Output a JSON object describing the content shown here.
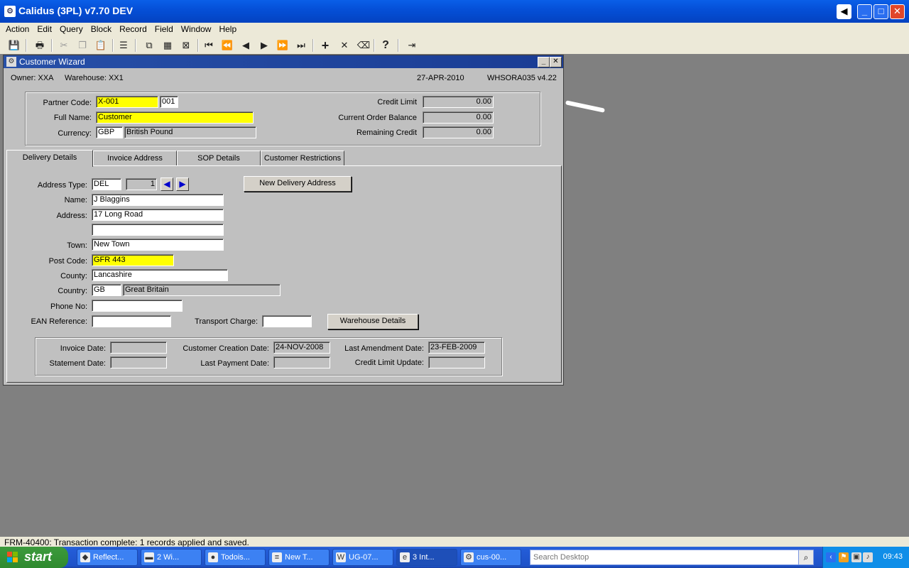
{
  "app": {
    "title": "Calidus (3PL) v7.70 DEV",
    "back_icon": "◀",
    "min_icon": "_",
    "max_icon": "□",
    "close_icon": "✕"
  },
  "menu": [
    "Action",
    "Edit",
    "Query",
    "Block",
    "Record",
    "Field",
    "Window",
    "Help"
  ],
  "form": {
    "title": "Customer Wizard",
    "owner_text": "Owner:  XXA",
    "warehouse_text": "Warehouse:  XX1",
    "date": "27-APR-2010",
    "form_id": "WHSORA035  v4.22",
    "header": {
      "partner_code_label": "Partner Code:",
      "partner_code": "X-001",
      "partner_suffix": "001",
      "full_name_label": "Full Name:",
      "full_name": "Customer",
      "currency_label": "Currency:",
      "currency_code": "GBP",
      "currency_name": "British Pound",
      "credit_limit_label": "Credit Limit",
      "credit_limit": "0.00",
      "order_balance_label": "Current Order Balance",
      "order_balance": "0.00",
      "remaining_credit_label": "Remaining Credit",
      "remaining_credit": "0.00"
    },
    "tabs": [
      "Delivery Details",
      "Invoice Address",
      "SOP Details",
      "Customer Restrictions"
    ],
    "delivery": {
      "address_type_label": "Address Type:",
      "address_type": "DEL",
      "sequence": "1",
      "new_address_button": "New Delivery Address",
      "name_label": "Name:",
      "name": "J Blaggins",
      "address_label": "Address:",
      "address1": "17 Long Road",
      "address2": "",
      "town_label": "Town:",
      "town": "New Town",
      "post_code_label": "Post Code:",
      "post_code": "GFR 443",
      "county_label": "County:",
      "county": "Lancashire",
      "country_label": "Country:",
      "country_code": "GB",
      "country_name": "Great Britain",
      "phone_label": "Phone No:",
      "phone": "",
      "ean_label": "EAN Reference:",
      "ean": "",
      "transport_label": "Transport Charge:",
      "transport": "",
      "warehouse_button": "Warehouse Details"
    },
    "dates": {
      "invoice_date_label": "Invoice Date:",
      "invoice_date": "",
      "statement_date_label": "Statement Date:",
      "statement_date": "",
      "creation_label": "Customer Creation Date:",
      "creation_date": "24-NOV-2008",
      "last_payment_label": "Last Payment Date:",
      "last_payment": "",
      "amendment_label": "Last Amendment Date:",
      "amendment_date": "23-FEB-2009",
      "credit_update_label": "Credit Limit Update:",
      "credit_update": ""
    }
  },
  "status": "FRM-40400: Transaction complete: 1 records applied and saved.",
  "taskbar": {
    "start": "start",
    "items": [
      "Reflect...",
      "2 Wi...",
      "Todois...",
      "New T...",
      "UG-07...",
      "3 Int...",
      "cus-00..."
    ],
    "search_placeholder": "Search Desktop",
    "clock": "09:43"
  }
}
